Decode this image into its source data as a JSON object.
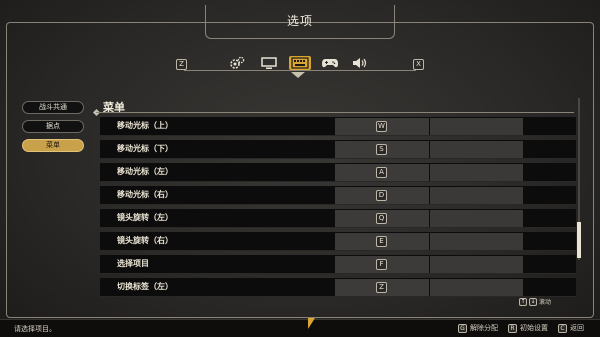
{
  "window": {
    "title": "选项"
  },
  "tabs": {
    "left_key": "Z",
    "right_key": "X",
    "items": [
      {
        "icon": "gears-icon",
        "active": false
      },
      {
        "icon": "monitor-icon",
        "active": false
      },
      {
        "icon": "keyboard-icon",
        "active": true
      },
      {
        "icon": "gamepad-icon",
        "active": false
      },
      {
        "icon": "speaker-icon",
        "active": false
      }
    ]
  },
  "sidebar": {
    "items": [
      {
        "label": "战斗共通",
        "active": false
      },
      {
        "label": "据点",
        "active": false
      },
      {
        "label": "菜单",
        "active": true
      }
    ]
  },
  "section": {
    "title": "菜单"
  },
  "bindings": [
    {
      "label": "移动光标（上）",
      "key": "W"
    },
    {
      "label": "移动光标（下）",
      "key": "S"
    },
    {
      "label": "移动光标（左）",
      "key": "A"
    },
    {
      "label": "移动光标（右）",
      "key": "D"
    },
    {
      "label": "镜头旋转（左）",
      "key": "Q"
    },
    {
      "label": "镜头旋转（右）",
      "key": "E"
    },
    {
      "label": "选择项目",
      "key": "F"
    },
    {
      "label": "切换标签（左）",
      "key": "Z"
    }
  ],
  "scroll_hint": {
    "key1": "↑",
    "key2": "↓",
    "label": "滚动"
  },
  "footer": {
    "hint": "请选择项目。",
    "actions": [
      {
        "key": "G",
        "label": "解除分配"
      },
      {
        "key": "R",
        "label": "初始设置"
      },
      {
        "key": "C",
        "label": "返回"
      }
    ]
  },
  "colors": {
    "accent": "#d9a634",
    "active_sidebar": "#c8a14a",
    "row_bg": "#0c0c0c",
    "cell_bg": "#3c3b39"
  }
}
